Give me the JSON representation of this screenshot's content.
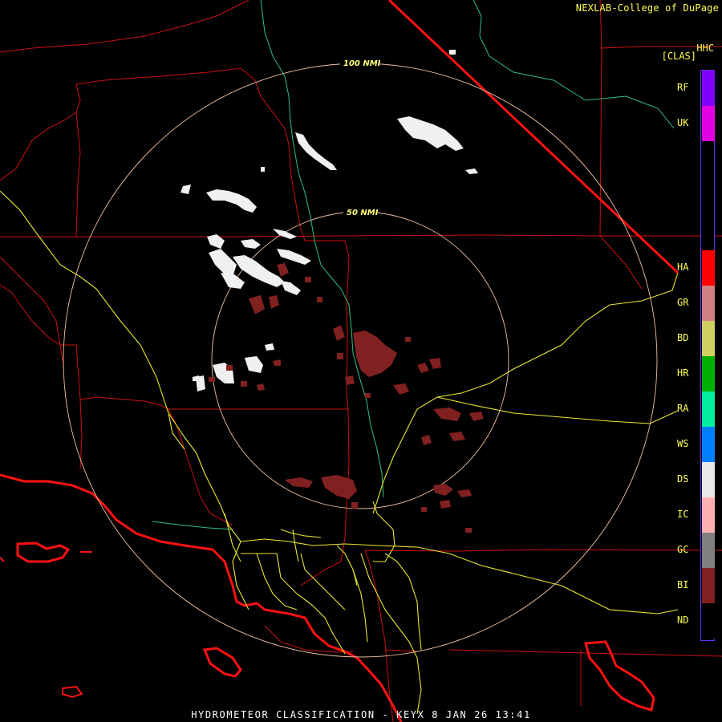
{
  "credit": "NEXLAB-College of DuPage",
  "legend": {
    "product": "HHC",
    "code": "[CLAS]",
    "items": [
      {
        "code": "RF",
        "color": "#8000ff"
      },
      {
        "code": "UK",
        "color": "#e000e0"
      },
      {
        "code": "HA",
        "color": "#ff0000"
      },
      {
        "code": "GR",
        "color": "#d08080"
      },
      {
        "code": "BD",
        "color": "#d0d060"
      },
      {
        "code": "HR",
        "color": "#00b000"
      },
      {
        "code": "RA",
        "color": "#00f0a0"
      },
      {
        "code": "WS",
        "color": "#0080ff"
      },
      {
        "code": "DS",
        "color": "#e8e8e8"
      },
      {
        "code": "IC",
        "color": "#ffb0b0"
      },
      {
        "code": "GC",
        "color": "#808080"
      },
      {
        "code": "BI",
        "color": "#802020"
      },
      {
        "code": "ND",
        "color": "#000000"
      }
    ]
  },
  "range_rings": [
    {
      "label": "100 NMI"
    },
    {
      "label": "50 NMI"
    }
  ],
  "footer": "HYDROMETEOR CLASSIFICATION - KEYX 8 JAN 26 13:41",
  "colors": {
    "county_lines": "#cc1111",
    "coastline": "#ff1111",
    "highways": "#e8e830",
    "rivers": "#30c080",
    "range_ring": "#f0c0a0",
    "dry_snow_echo": "#f0f0f0",
    "biological_echo": "#802020"
  }
}
